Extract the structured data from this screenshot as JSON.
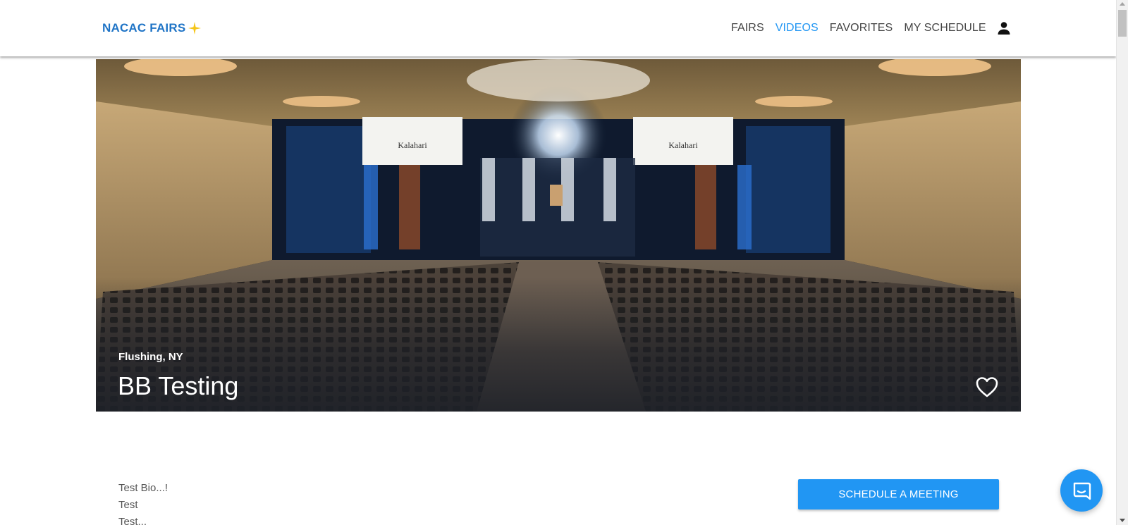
{
  "header": {
    "logo_text": "NACAC FAIRS",
    "nav": [
      {
        "label": "FAIRS",
        "active": false
      },
      {
        "label": "VIDEOS",
        "active": true
      },
      {
        "label": "FAVORITES",
        "active": false
      },
      {
        "label": "MY SCHEDULE",
        "active": false
      }
    ],
    "user_icon": "person-icon"
  },
  "hero": {
    "location": "Flushing, NY",
    "title": "BB Testing",
    "favorite_icon": "heart-outline-icon",
    "screen_text_left": "Kalahari",
    "screen_text_right": "Kalahari"
  },
  "content": {
    "bio_lines": [
      "Test Bio...!",
      "Test",
      "Test..."
    ],
    "schedule_button": "SCHEDULE A MEETING"
  },
  "chat": {
    "icon": "chat-icon"
  },
  "colors": {
    "accent": "#2196f3",
    "logo": "#1f74c6",
    "logo_star": "#f5c518",
    "text": "#555555"
  }
}
